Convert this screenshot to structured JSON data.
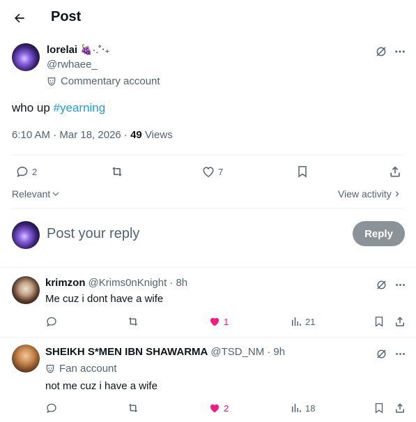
{
  "header": {
    "title": "Post"
  },
  "post": {
    "display_name": "lorelai",
    "name_emoji": "🍇·.˚‧₊",
    "handle": "@rwhaee_",
    "account_label": "Commentary account",
    "text_prefix": "who up ",
    "hashtag": "#yearning",
    "time": "6:10 AM · Mar 18, 2026 · ",
    "views_count": "49",
    "views_label": " Views",
    "replies": "2",
    "likes": "7",
    "sort_label": "Relevant",
    "view_activity": "View activity"
  },
  "composer": {
    "placeholder": "Post your reply",
    "reply_label": "Reply"
  },
  "replies": [
    {
      "name": "krimzon",
      "handle": "@Krims0nKnight",
      "time": "· 8h",
      "text": "Me cuz i dont have a wife",
      "likes": "1",
      "views": "21"
    },
    {
      "name": "SHEIKH S*MEN IBN SHAWARMA",
      "handle": "@TSD_NM",
      "time": "· 9h",
      "label": "Fan account",
      "text": "not me cuz i have a wife",
      "likes": "2",
      "views": "18"
    }
  ]
}
